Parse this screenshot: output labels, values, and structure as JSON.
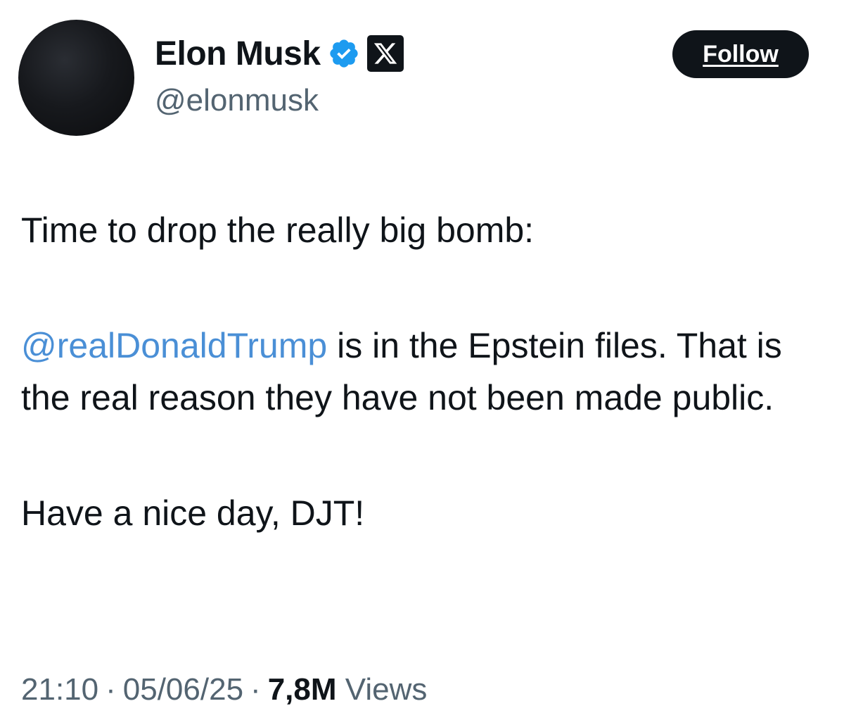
{
  "author": {
    "display_name": "Elon Musk",
    "handle": "@elonmusk",
    "verified_icon": "verified-badge-icon",
    "affiliate_icon": "x-logo-icon"
  },
  "follow_button": {
    "label": "Follow"
  },
  "tweet": {
    "line1": "Time to drop the really big bomb:",
    "mention": "@realDonaldTrump",
    "line2_rest": " is in the Epstein files. That is the real reason they have not been made public.",
    "line3": "Have a nice day, DJT!"
  },
  "meta": {
    "time": "21:10",
    "separator": "·",
    "date": "05/06/25",
    "views_count": "7,8M",
    "views_label": "Views"
  },
  "colors": {
    "text": "#0f1419",
    "secondary": "#536471",
    "link": "#4a8fd6",
    "verified": "#1d9bf0",
    "button_bg": "#0f1419"
  }
}
